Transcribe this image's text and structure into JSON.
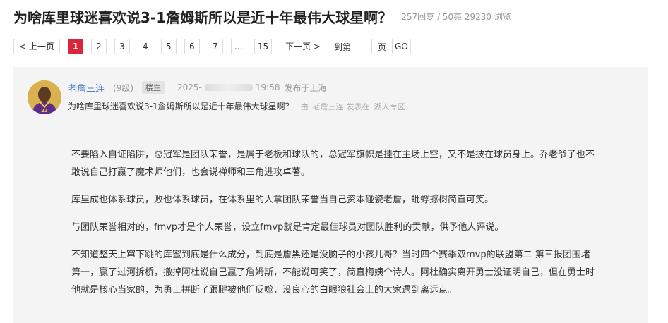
{
  "thread": {
    "title": "为啥库里球迷喜欢说3-1詹姆斯所以是近十年最伟大球星啊？",
    "stats": "257回复 / 50亮 29230 浏览"
  },
  "pager": {
    "prev": "< 上一页",
    "pages": [
      "1",
      "2",
      "3",
      "4",
      "5",
      "6",
      "7",
      "...",
      "15"
    ],
    "active": "1",
    "next": "下一页 >",
    "goto_label": "到第",
    "page_unit": "页",
    "go_label": "GO",
    "page_input_value": ""
  },
  "post": {
    "author": "老詹三连",
    "level": "(9级)",
    "op_badge": "楼主",
    "date_prefix": "2025-",
    "time": "19:58",
    "location": "发布于上海",
    "subject": "为啥库里球迷喜欢说3-1詹姆斯所以是近十年最伟大球星啊？",
    "by": "由",
    "by_author": "老詹三连",
    "posted_in": "发表在",
    "board": "湖人专区",
    "paragraphs": [
      "不要陷入自证陷阱，总冠军是团队荣誉，是属于老板和球队的，总冠军旗帜是挂在主场上空，又不是披在球员身上。乔老爷子也不敢说自己打赢了魔术师他们，也会说禅师和三角进攻卓著。",
      "库里成也体系球员，败也体系球员，在体系里的人拿团队荣誉当自己资本碰瓷老詹，蚍蜉撼树简直可笑。",
      "与团队荣誉相对的，fmvp才是个人荣誉，设立fmvp就是肯定最佳球员对团队胜利的贡献，供予他人评说。",
      "不知道整天上窜下跳的库蜜到底是什么成分，到底是詹黑还是没脑子的小孩儿哥？当时四个赛季双mvp的联盟第二 第三报团围堵第一，赢了过河拆桥，撤掉阿杜说自己赢了詹姆斯，不能说可笑了，简直梅姨个诗人。阿杜确实离开勇士没证明自己，但在勇士时他就是核心当家的，为勇士拼断了跟腱被他们反噬，没良心的白眼狼社会上的大家遇到离远点。"
    ]
  },
  "colors": {
    "accent": "#d9263b",
    "author_link": "#4d7bc4",
    "post_bg": "#f4f4f4"
  }
}
